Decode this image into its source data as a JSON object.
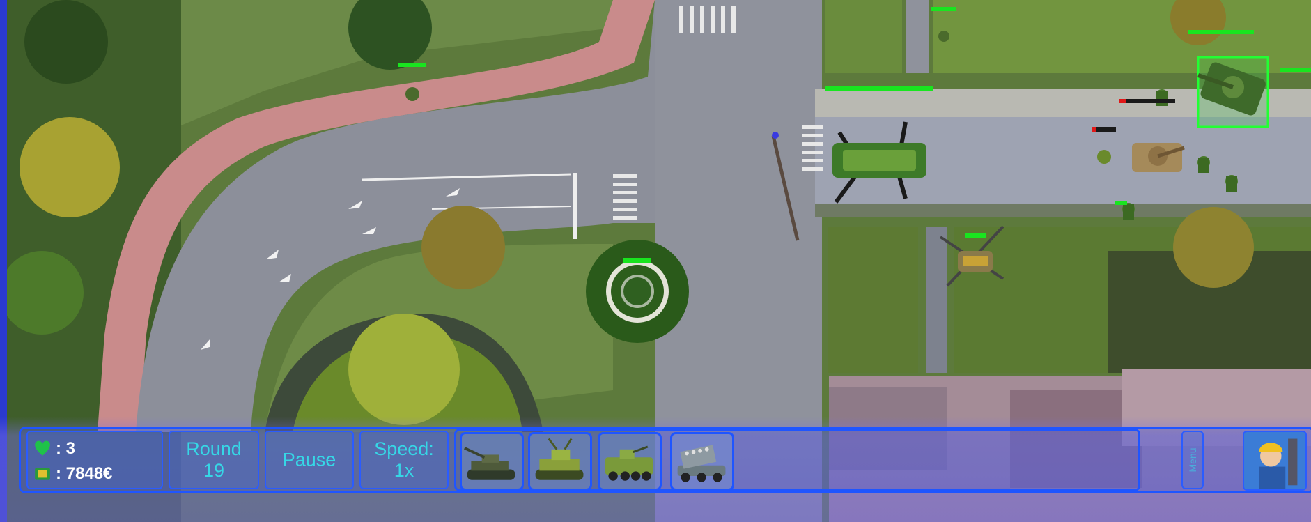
{
  "hud": {
    "lives": ": 3",
    "money": ": 7848€",
    "round_label": "Round",
    "round_value": "19",
    "pause_label": "Pause",
    "speed_label": "Speed:",
    "speed_value": "1x",
    "menu_label": "Menu"
  },
  "units": [
    {
      "name": "tank",
      "icon": "tank-icon"
    },
    {
      "name": "anti-air tank",
      "icon": "aa-tank-icon"
    },
    {
      "name": "armored personnel carrier",
      "icon": "apc-icon"
    },
    {
      "name": "rocket launcher",
      "icon": "rocket-launcher-icon"
    }
  ],
  "health": {
    "turret": 1.0,
    "enemy_tank_top": 0.95,
    "enemy_walker": 1.0,
    "enemy_tank_mid": 0.2,
    "soldier_lower": 1.0,
    "drone": 1.0
  },
  "colors": {
    "hud_border": "#1f55ff",
    "hud_text": "#36d7e6",
    "health_bar": "#19e51f",
    "selection": "#22ff33"
  }
}
